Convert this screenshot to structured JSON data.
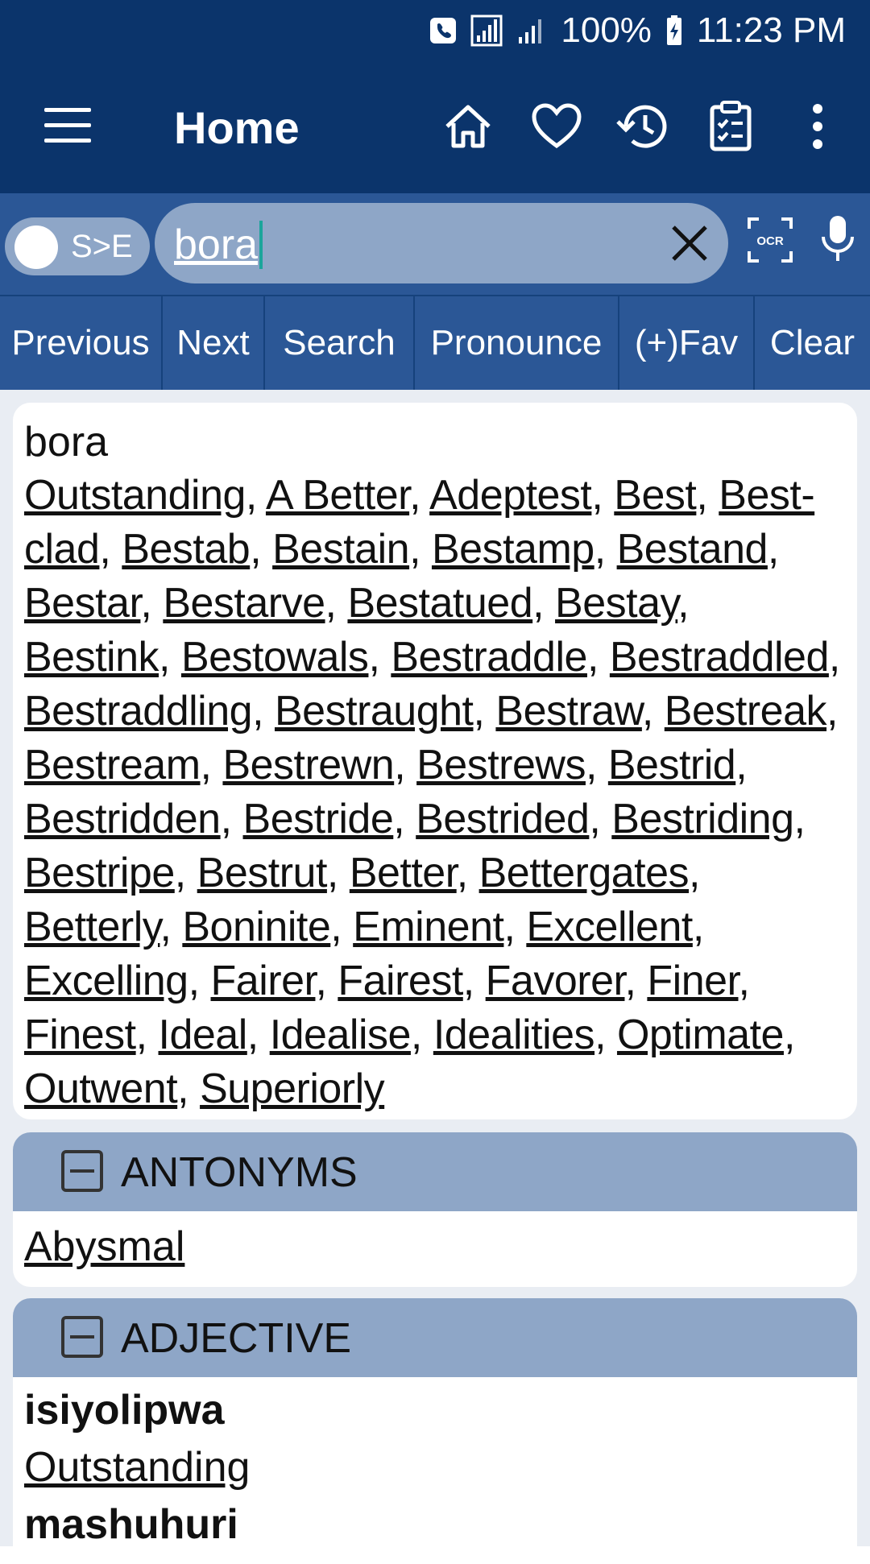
{
  "statusbar": {
    "battery": "100%",
    "time": "11:23 PM"
  },
  "appbar": {
    "title": "Home"
  },
  "search": {
    "mode": "S>E",
    "value": "bora"
  },
  "buttons": [
    "Previous",
    "Next",
    "Search",
    "Pronounce",
    "(+)Fav",
    "Clear"
  ],
  "entry": {
    "headword": "bora",
    "synonyms": [
      "Outstanding",
      "A Better",
      "Adeptest",
      "Best",
      "Best-clad",
      "Bestab",
      "Bestain",
      "Bestamp",
      "Bestand",
      "Bestar",
      "Bestarve",
      "Bestatued",
      "Bestay",
      "Bestink",
      "Bestowals",
      "Bestraddle",
      "Bestraddled",
      "Bestraddling",
      "Bestraught",
      "Bestraw",
      "Bestreak",
      "Bestream",
      "Bestrewn",
      "Bestrews",
      "Bestrid",
      "Bestridden",
      "Bestride",
      "Bestrided",
      "Bestriding",
      "Bestripe",
      "Bestrut",
      "Better",
      "Bettergates",
      "Betterly",
      "Boninite",
      "Eminent",
      "Excellent",
      "Excelling",
      "Fairer",
      "Fairest",
      "Favorer",
      "Finer",
      "Finest",
      "Ideal",
      "Idealise",
      "Idealities",
      "Optimate",
      "Outwent",
      "Superiorly"
    ]
  },
  "antonyms": {
    "title": "ANTONYMS",
    "items": [
      "Abysmal"
    ]
  },
  "adjective": {
    "title": "ADJECTIVE",
    "word1": "isiyolipwa",
    "link1": "Outstanding",
    "word2": "mashuhuri"
  },
  "colors": {
    "primary": "#0b346b",
    "secondary": "#2b5796",
    "section": "#8ea6c7"
  }
}
